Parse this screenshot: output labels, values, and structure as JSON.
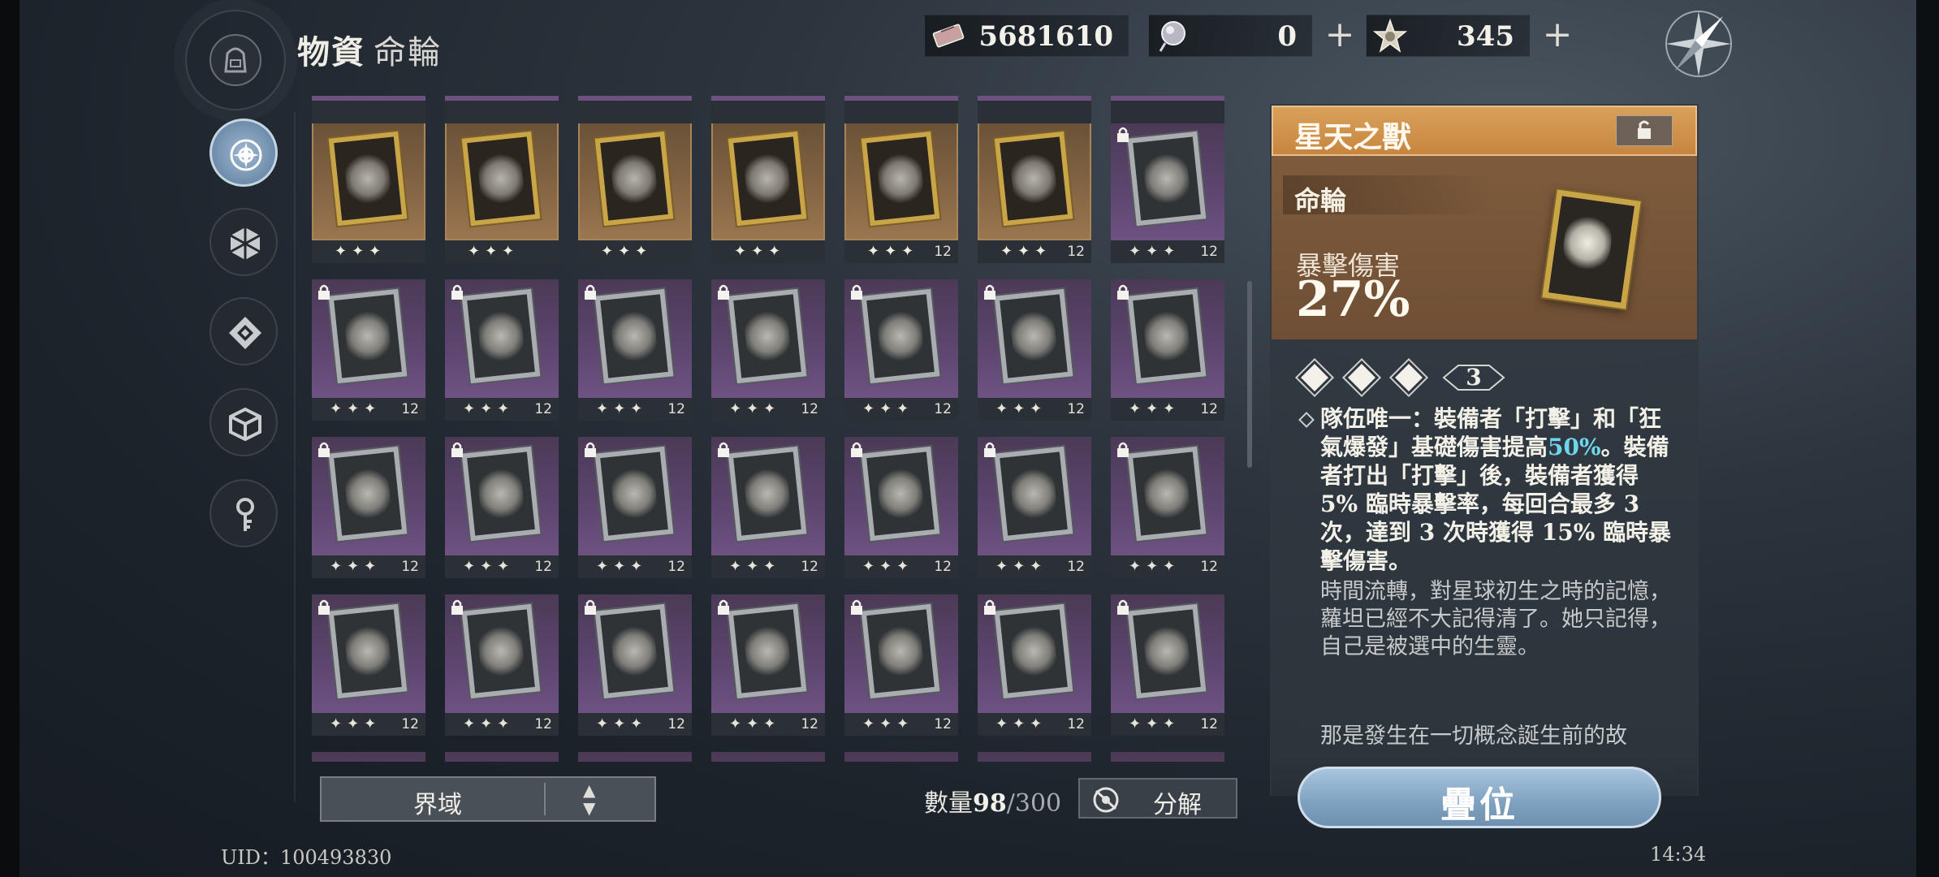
{
  "header": {
    "title": "物資",
    "subtitle": "命輪",
    "resources": [
      {
        "icon": "ticket-icon",
        "value": "5681610"
      },
      {
        "icon": "orb-icon",
        "value": "0"
      },
      {
        "icon": "star-crystal-icon",
        "value": "345"
      }
    ],
    "compass_icon": "compass-icon"
  },
  "sidebar": {
    "items": [
      {
        "icon": "wheel-compass-icon",
        "active": true
      },
      {
        "icon": "hexagon-icon",
        "active": false
      },
      {
        "icon": "diamond-badge-icon",
        "active": false
      },
      {
        "icon": "cube-icon",
        "active": false
      },
      {
        "icon": "key-icon",
        "active": false
      }
    ]
  },
  "grid": {
    "rows": [
      [
        {
          "rarity": "gold",
          "locked": false,
          "stars": "✦✦✦",
          "level": ""
        },
        {
          "rarity": "gold",
          "locked": false,
          "stars": "✦✦✦",
          "level": ""
        },
        {
          "rarity": "gold",
          "locked": false,
          "stars": "✦✦✦",
          "level": ""
        },
        {
          "rarity": "gold",
          "locked": false,
          "stars": "✦✦✦",
          "level": ""
        },
        {
          "rarity": "gold",
          "locked": false,
          "stars": "✦✦✦",
          "level": "12"
        },
        {
          "rarity": "gold",
          "locked": false,
          "stars": "✦✦✦",
          "level": "12"
        },
        {
          "rarity": "purple",
          "locked": true,
          "stars": "✦✦✦",
          "level": "12"
        }
      ],
      [
        {
          "rarity": "purple",
          "locked": true,
          "stars": "✦✦✦",
          "level": "12"
        },
        {
          "rarity": "purple",
          "locked": true,
          "stars": "✦✦✦",
          "level": "12"
        },
        {
          "rarity": "purple",
          "locked": true,
          "stars": "✦✦✦",
          "level": "12"
        },
        {
          "rarity": "purple",
          "locked": true,
          "stars": "✦✦✦",
          "level": "12"
        },
        {
          "rarity": "purple",
          "locked": true,
          "stars": "✦✦✦",
          "level": "12"
        },
        {
          "rarity": "purple",
          "locked": true,
          "stars": "✦✦✦",
          "level": "12"
        },
        {
          "rarity": "purple",
          "locked": true,
          "stars": "✦✦✦",
          "level": "12"
        }
      ],
      [
        {
          "rarity": "purple",
          "locked": true,
          "stars": "✦✦✦",
          "level": "12"
        },
        {
          "rarity": "purple",
          "locked": true,
          "stars": "✦✦✦",
          "level": "12"
        },
        {
          "rarity": "purple",
          "locked": true,
          "stars": "✦✦✦",
          "level": "12"
        },
        {
          "rarity": "purple",
          "locked": true,
          "stars": "✦✦✦",
          "level": "12"
        },
        {
          "rarity": "purple",
          "locked": true,
          "stars": "✦✦✦",
          "level": "12"
        },
        {
          "rarity": "purple",
          "locked": true,
          "stars": "✦✦✦",
          "level": "12"
        },
        {
          "rarity": "purple",
          "locked": true,
          "stars": "✦✦✦",
          "level": "12"
        }
      ],
      [
        {
          "rarity": "purple",
          "locked": true,
          "stars": "✦✦✦",
          "level": "12"
        },
        {
          "rarity": "purple",
          "locked": true,
          "stars": "✦✦✦",
          "level": "12"
        },
        {
          "rarity": "purple",
          "locked": true,
          "stars": "✦✦✦",
          "level": "12"
        },
        {
          "rarity": "purple",
          "locked": true,
          "stars": "✦✦✦",
          "level": "12"
        },
        {
          "rarity": "purple",
          "locked": true,
          "stars": "✦✦✦",
          "level": "12"
        },
        {
          "rarity": "purple",
          "locked": true,
          "stars": "✦✦✦",
          "level": "12"
        },
        {
          "rarity": "purple",
          "locked": true,
          "stars": "✦✦✦",
          "level": "12"
        }
      ]
    ]
  },
  "bottom": {
    "filter_label": "界域",
    "count_label": "數量",
    "count_current": "98",
    "count_max": "/300",
    "decompose_label": "分解",
    "uid": "UID：100493830",
    "clock": "14:34"
  },
  "detail": {
    "name": "星天之獸",
    "category": "命輪",
    "stat_name": "暴擊傷害",
    "stat_value": "27%",
    "rank": "3",
    "effect_prefix": "隊伍唯一：裝備者「打擊」和「狂氣爆發」基礎傷害提高",
    "effect_highlight": "50%",
    "effect_suffix": "。裝備者打出「打擊」後，裝備者獲得 5% 臨時暴擊率，每回合最多 3 次，達到 3 次時獲得 15% 臨時暴擊傷害。",
    "lore_1": "時間流轉，對星球初生之時的記憶，蘿坦已經不大記得清了。她只記得，自己是被選中的生靈。",
    "lore_2": "那是發生在一切概念誕生前的故",
    "stack_button": "疊位"
  },
  "colors": {
    "gold_card": "#866645",
    "purple_card": "#5e4670",
    "panel_header": "#c7863f",
    "highlight": "#6fd4ec",
    "button": "#7fa1c0"
  }
}
